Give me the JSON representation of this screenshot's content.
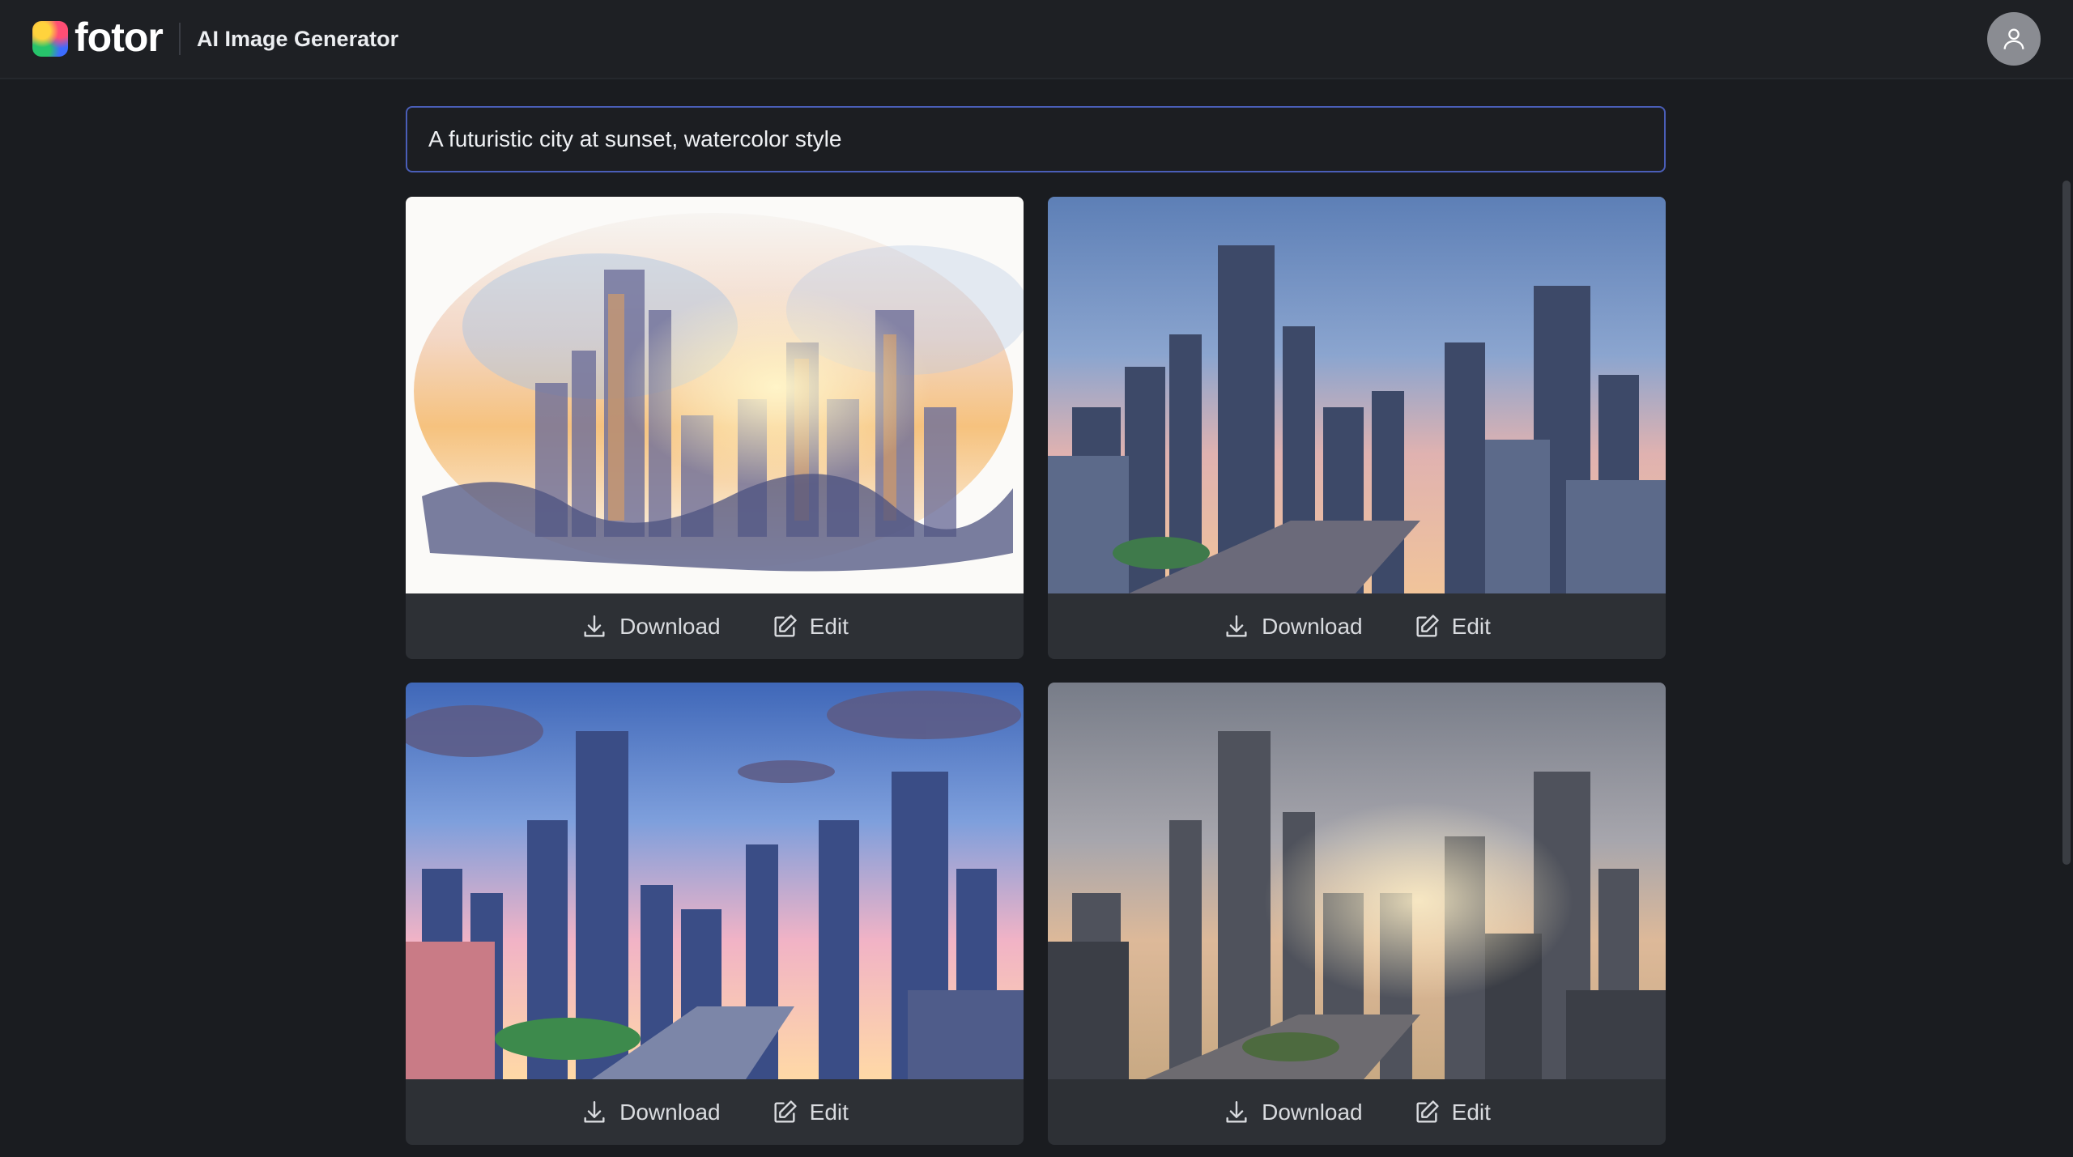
{
  "header": {
    "logo_text": "fotor",
    "app_title": "AI Image Generator",
    "avatar_icon": "user-icon"
  },
  "prompt": {
    "value": "A futuristic city at sunset, watercolor style"
  },
  "cards": [
    {
      "style": "watercolor-wash",
      "download_label": "Download",
      "edit_label": "Edit"
    },
    {
      "style": "blue-sky-sketch",
      "download_label": "Download",
      "edit_label": "Edit"
    },
    {
      "style": "anime-clouds",
      "download_label": "Download",
      "edit_label": "Edit"
    },
    {
      "style": "hazy-painterly",
      "download_label": "Download",
      "edit_label": "Edit"
    }
  ],
  "icons": {
    "download": "download-icon",
    "edit": "edit-icon"
  },
  "colors": {
    "background": "#1a1c20",
    "input_border": "#4a5eb8",
    "card_bar": "#2d3035"
  }
}
